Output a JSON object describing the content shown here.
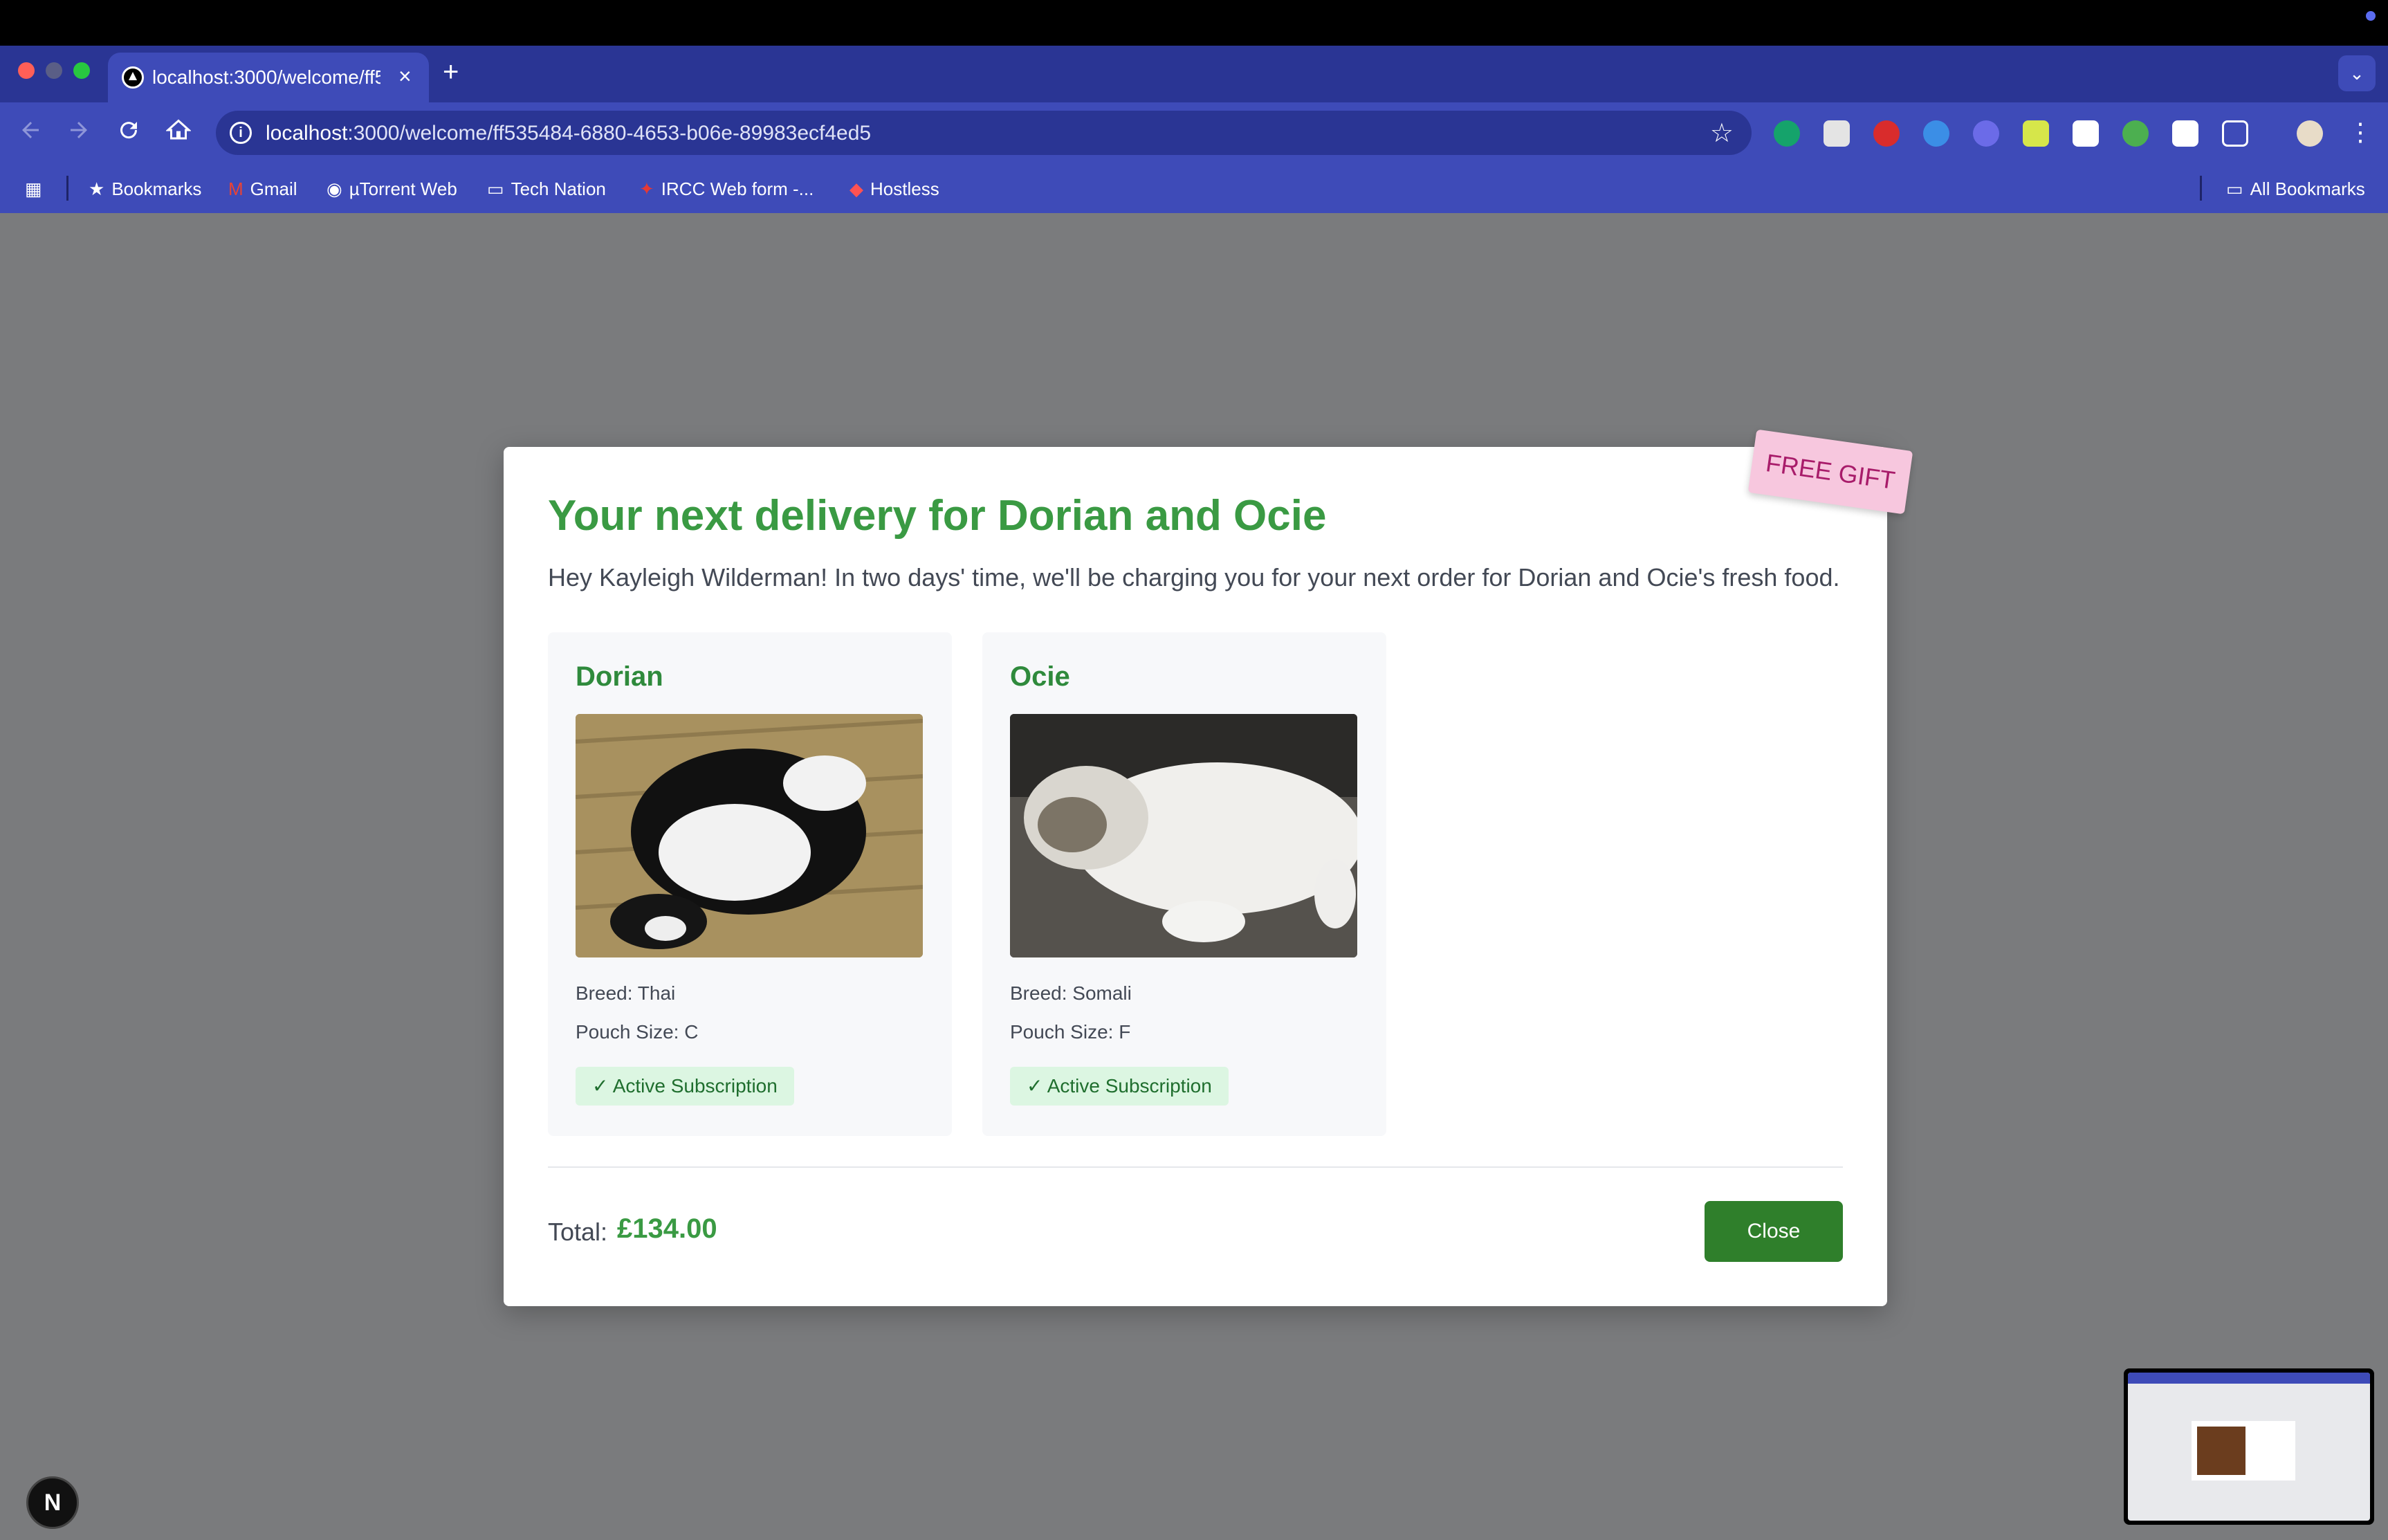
{
  "browser": {
    "tab_title": "localhost:3000/welcome/ff535484-6880-4653-b06e-89983ecf4ed5",
    "url_host": "localhost",
    "url_path": ":3000/welcome/ff535484-6880-4653-b06e-89983ecf4ed5",
    "new_tab": "+",
    "tab_close": "×",
    "tab_menu": "⌄",
    "info": "i",
    "bookmarks": {
      "apps": "▦",
      "items": [
        "Bookmarks",
        "Gmail",
        "µTorrent Web",
        "Tech Nation",
        "IRCC Web form -...",
        "Hostless"
      ],
      "all": "All Bookmarks"
    }
  },
  "modal": {
    "ribbon": "FREE GIFT",
    "title": "Your next delivery for Dorian and Ocie",
    "subtitle": "Hey Kayleigh Wilderman! In two days' time, we'll be charging you for your next order for Dorian and Ocie's fresh food.",
    "pets": [
      {
        "name": "Dorian",
        "breed": "Breed: Thai",
        "pouch": "Pouch Size: C",
        "status": "✓ Active Subscription"
      },
      {
        "name": "Ocie",
        "breed": "Breed: Somali",
        "pouch": "Pouch Size: F",
        "status": "✓ Active Subscription"
      }
    ],
    "total_label": "Total:",
    "total_amount": "£134.00",
    "close_label": "Close"
  },
  "overlay": {
    "next_badge": "N"
  },
  "colors": {
    "accent_green": "#3a9a43",
    "button_green": "#2f7f2b",
    "ribbon_pink": "#f7c7de",
    "chrome_blue": "#3e4bb8"
  }
}
